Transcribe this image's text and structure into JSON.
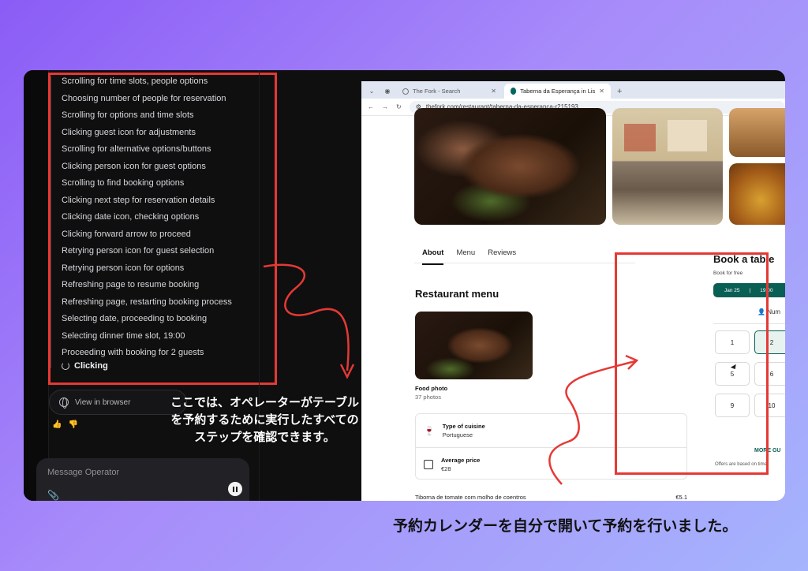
{
  "operator": {
    "steps": [
      "Scrolling for time slots, people options",
      "Choosing number of people for reservation",
      "Scrolling for options and time slots",
      "Clicking guest icon for adjustments",
      "Scrolling for alternative options/buttons",
      "Clicking person icon for guest options",
      "Scrolling to find booking options",
      "Clicking next step for reservation details",
      "Clicking date icon, checking options",
      "Clicking forward arrow to proceed",
      "Retrying person icon for guest selection",
      "Retrying person icon for options",
      "Refreshing page to resume booking",
      "Refreshing page, restarting booking process",
      "Selecting date, proceeding to booking",
      "Selecting dinner time slot, 19:00",
      "Proceeding with booking for 2 guests"
    ],
    "current_step": "Clicking",
    "view_in_browser": "View in browser",
    "message_placeholder": "Message Operator"
  },
  "browser": {
    "tabs": [
      "The Fork - Search",
      "Taberna da Esperança in Lis"
    ],
    "url": "thefork.com/restaurant/taberna-da-esperanca-r215193"
  },
  "restaurant": {
    "nav_tabs": [
      "About",
      "Menu",
      "Reviews"
    ],
    "menu_title": "Restaurant menu",
    "photo_caption": "Food photo",
    "photo_count": "37 photos",
    "cuisine_label": "Type of cuisine",
    "cuisine_value": "Portuguese",
    "price_label": "Average price",
    "price_value": "€28",
    "dish_name": "Tiborna de tomate com molho de coentros",
    "dish_price": "€5.1"
  },
  "booking": {
    "title": "Book a table",
    "subtitle": "Book for free",
    "date": "Jan 25",
    "time": "19:00",
    "num_label": "Num",
    "people_options": [
      "1",
      "2",
      "5",
      "6",
      "9",
      "10"
    ],
    "selected_people": "2",
    "more_guests": "MORE GU",
    "offers_note": "Offers are based on time"
  },
  "annotations": {
    "left_note": "ここでは、オペレーターがテーブルを予約するために実行したすべてのステップを確認できます。",
    "bottom_caption": "予約カレンダーを自分で開いて予約を行いました。"
  },
  "colors": {
    "highlight_red": "#e53935",
    "brand_green": "#0a5f55",
    "background_gradient_start": "#8b5cf6"
  }
}
